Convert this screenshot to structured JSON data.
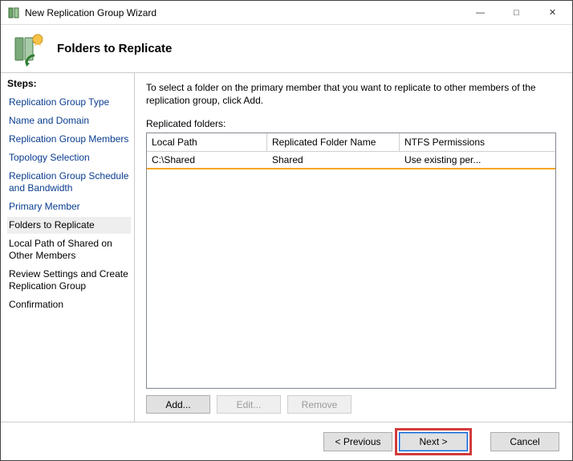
{
  "window": {
    "title": "New Replication Group Wizard"
  },
  "header": {
    "title": "Folders to Replicate"
  },
  "sidebar": {
    "title": "Steps:",
    "items": [
      {
        "label": "Replication Group Type",
        "state": "done"
      },
      {
        "label": "Name and Domain",
        "state": "done"
      },
      {
        "label": "Replication Group Members",
        "state": "done"
      },
      {
        "label": "Topology Selection",
        "state": "done"
      },
      {
        "label": "Replication Group Schedule and Bandwidth",
        "state": "done"
      },
      {
        "label": "Primary Member",
        "state": "done"
      },
      {
        "label": "Folders to Replicate",
        "state": "current"
      },
      {
        "label": "Local Path of Shared on Other Members",
        "state": "pending"
      },
      {
        "label": "Review Settings and Create Replication Group",
        "state": "pending"
      },
      {
        "label": "Confirmation",
        "state": "pending"
      }
    ]
  },
  "main": {
    "description": "To select a folder on the primary member that you want to replicate to other members of the replication group, click Add.",
    "list_label": "Replicated folders:",
    "columns": [
      "Local Path",
      "Replicated Folder Name",
      "NTFS Permissions"
    ],
    "rows": [
      {
        "local_path": "C:\\Shared",
        "name": "Shared",
        "perms": "Use existing per..."
      }
    ],
    "buttons": {
      "add": "Add...",
      "edit": "Edit...",
      "remove": "Remove"
    }
  },
  "footer": {
    "previous": "< Previous",
    "next": "Next >",
    "cancel": "Cancel"
  }
}
